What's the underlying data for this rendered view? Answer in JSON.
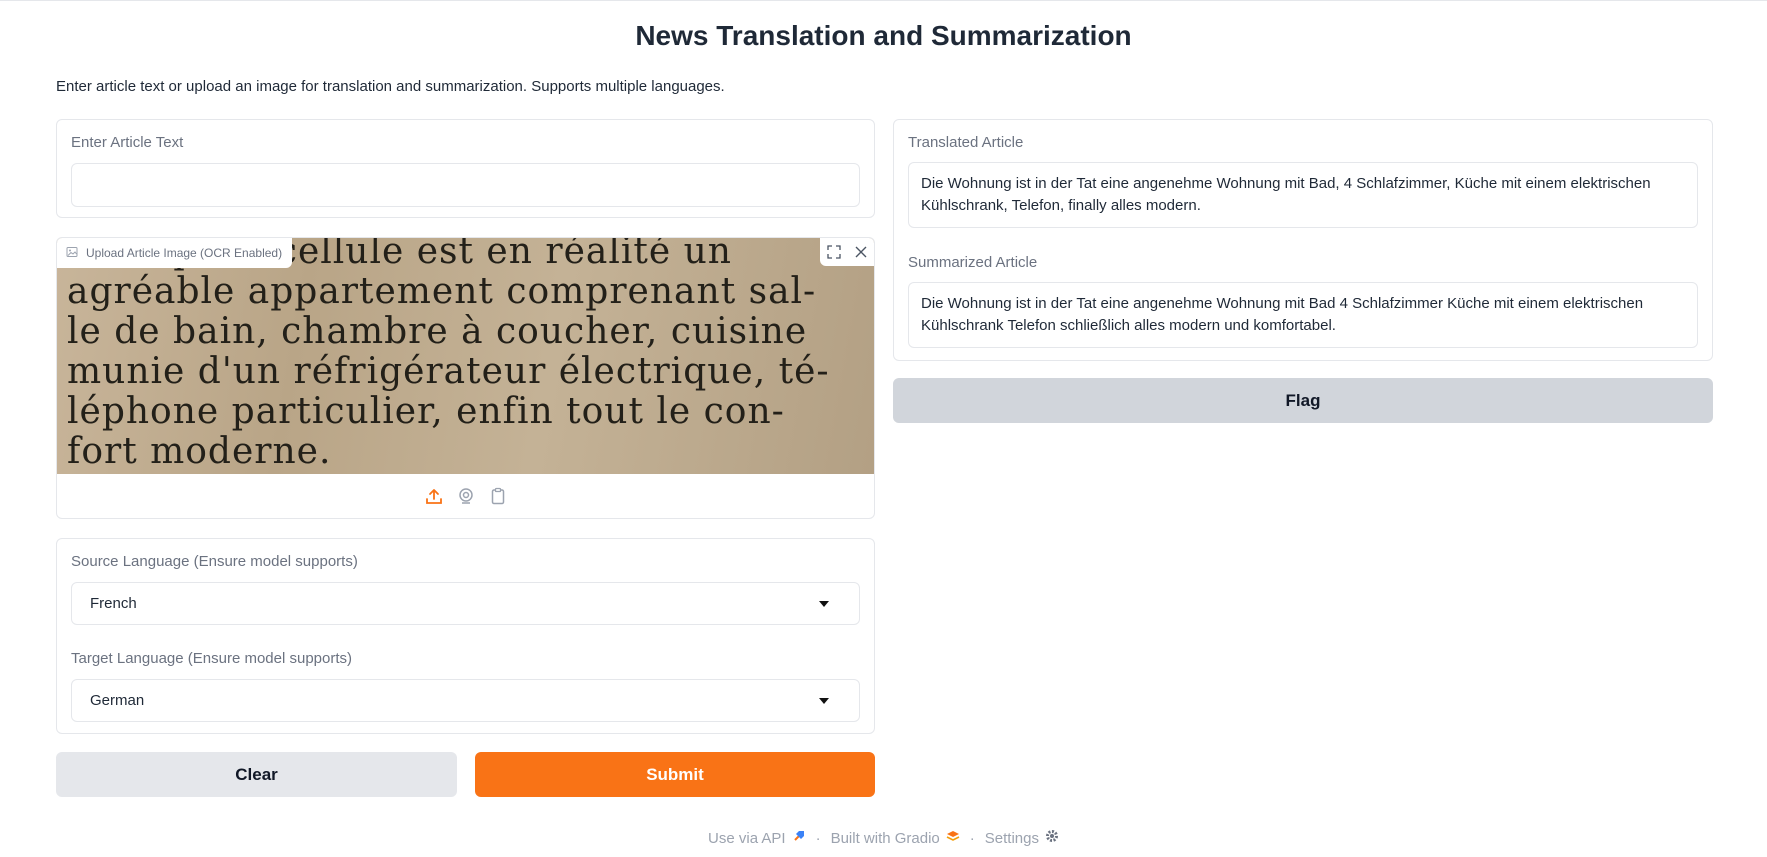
{
  "app": {
    "title": "News Translation and Summarization",
    "description": "Enter article text or upload an image for translation and summarization. Supports multiple languages."
  },
  "input": {
    "article_label": "Enter Article Text",
    "article_value": "",
    "image_label": "Upload Article Image (OCR Enabled)",
    "image_text_lines": [
      "eser qu sa cellule est en réalité un",
      "agréable appartement comprenant sal-",
      "le de bain, chambre à coucher, cuisine",
      "munie d'un réfrigérateur électrique, té-",
      "léphone particulier, enfin tout le con-",
      "fort moderne."
    ],
    "image_tools": [
      "fullscreen-icon",
      "close-icon"
    ],
    "image_sources": [
      "upload-icon",
      "webcam-icon",
      "clipboard-icon"
    ],
    "source_label": "Source Language (Ensure model supports)",
    "source_value": "French",
    "target_label": "Target Language (Ensure model supports)",
    "target_value": "German"
  },
  "buttons": {
    "clear": "Clear",
    "submit": "Submit",
    "flag": "Flag"
  },
  "output": {
    "translated_label": "Translated Article",
    "translated_text": "Die Wohnung ist in der Tat eine angenehme Wohnung mit Bad, 4 Schlafzimmer, Küche mit einem elektrischen Kühlschrank, Telefon, finally alles modern.",
    "summary_label": "Summarized Article",
    "summary_text": "Die Wohnung ist in der Tat eine angenehme Wohnung mit Bad 4 Schlafzimmer Küche mit einem elektrischen Kühlschrank Telefon schließlich alles modern und komfortabel."
  },
  "footer": {
    "api": "Use via API",
    "built": "Built with Gradio",
    "settings": "Settings",
    "separator": "·"
  },
  "colors": {
    "accent": "#f97316",
    "secondary_button": "#e5e7eb",
    "flag_button": "#d1d5db"
  }
}
